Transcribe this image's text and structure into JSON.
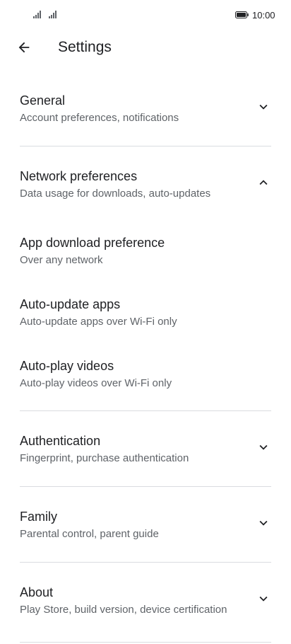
{
  "status_bar": {
    "time": "10:00",
    "icons": [
      "signal-icon",
      "signal-icon",
      "battery-icon"
    ]
  },
  "app_bar": {
    "title": "Settings",
    "back_icon": "arrow-back-icon"
  },
  "sections": [
    {
      "title": "General",
      "subtitle": "Account preferences, notifications",
      "expanded": false
    },
    {
      "title": "Network preferences",
      "subtitle": "Data usage for downloads, auto-updates",
      "expanded": true,
      "items": [
        {
          "title": "App download preference",
          "subtitle": "Over any network"
        },
        {
          "title": "Auto-update apps",
          "subtitle": "Auto-update apps over Wi-Fi only"
        },
        {
          "title": "Auto-play videos",
          "subtitle": "Auto-play videos over Wi-Fi only"
        }
      ]
    },
    {
      "title": "Authentication",
      "subtitle": "Fingerprint, purchase authentication",
      "expanded": false
    },
    {
      "title": "Family",
      "subtitle": "Parental control, parent guide",
      "expanded": false
    },
    {
      "title": "About",
      "subtitle": "Play Store, build version, device certification",
      "expanded": false
    }
  ],
  "colors": {
    "text_primary": "#202124",
    "text_secondary": "#5f6368",
    "divider": "#dadce0"
  }
}
